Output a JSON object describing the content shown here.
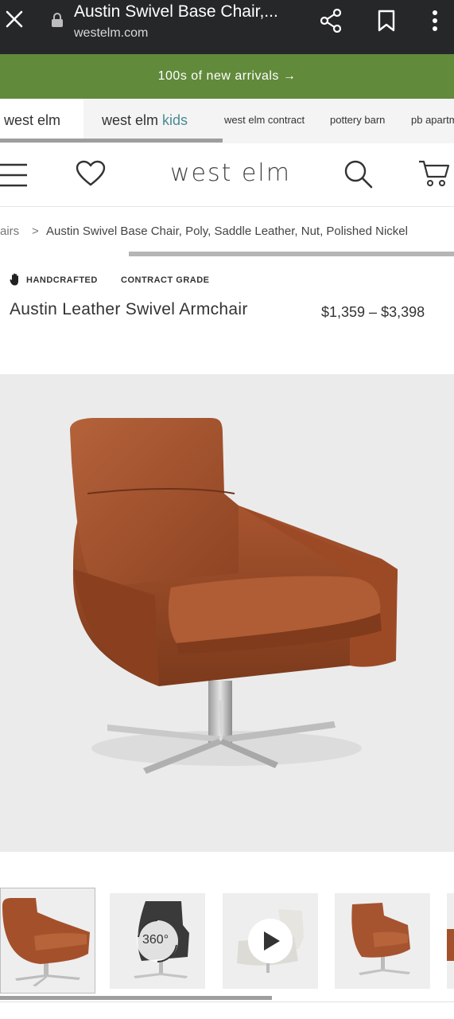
{
  "browser": {
    "title": "Austin Swivel Base Chair,...",
    "url": "westelm.com",
    "icons": [
      "close-icon",
      "lock-icon",
      "share-icon",
      "bookmark-icon",
      "more-vert-icon"
    ]
  },
  "promo": {
    "text": "100s of new arrivals →"
  },
  "brand_tabs": {
    "westelm": "west elm",
    "kids_prefix": "west elm ",
    "kids_suffix": "kids",
    "contract": "west elm contract",
    "pottery": "pottery barn",
    "pb": "pb apartment"
  },
  "header": {
    "logo": "west elm",
    "icons": [
      "menu-icon",
      "heart-icon",
      "search-icon",
      "cart-icon"
    ]
  },
  "breadcrumb": {
    "prev": "airs",
    "separator": ">",
    "current": "Austin Swivel Base Chair, Poly, Saddle Leather, Nut, Polished Nickel"
  },
  "product": {
    "badge_handcrafted": "HANDCRAFTED",
    "badge_contract": "CONTRACT GRADE",
    "title": "Austin Leather Swivel Armchair",
    "price": "$1,359 – $3,398"
  },
  "thumbnails": {
    "spin_label": "360°",
    "items": [
      "thumb-saddle-chair",
      "thumb-360-view",
      "thumb-video",
      "thumb-saddle-chair-front",
      "thumb-partial"
    ]
  },
  "colors": {
    "browser_bar": "#262729",
    "promo_green": "#618a3b",
    "kids_teal": "#4a8a96",
    "leather": "#a4512b"
  }
}
